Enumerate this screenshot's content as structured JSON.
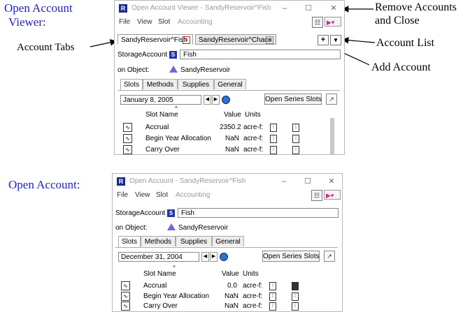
{
  "callouts": {
    "viewer_line1": "Open Account",
    "viewer_line2": "Viewer:",
    "account_tabs": "Account Tabs",
    "remove_line1": "Remove Accounts",
    "remove_line2": "and Close",
    "account_list": "Account List",
    "add_account": "Add Account",
    "open_account": "Open Account:"
  },
  "win1": {
    "title": "Open Account Viewer - SandyReservoir^Fish",
    "menu": [
      "File",
      "View",
      "Slot",
      "Accounting"
    ],
    "tabs": [
      "SandyReservoir^Fish",
      "SandyReservoir^Chaco"
    ],
    "plus": "+",
    "list_btn": "▾",
    "account_type": "StorageAccount",
    "s_badge": "S",
    "account_name": "Fish",
    "on_object_label": "on Object:",
    "object_name": "SandyReservoir",
    "subtabs": [
      "Slots",
      "Methods",
      "Supplies",
      "General"
    ],
    "date": "January 8, 2005",
    "series_btn": "Open Series Slots",
    "col_headers": {
      "name": "Slot Name",
      "value": "Value",
      "units": "Units"
    },
    "rows": [
      {
        "name": "Accrual",
        "value": "2350.2",
        "units": "acre-f:"
      },
      {
        "name": "Begin Year Allocation",
        "value": "NaN",
        "units": "acre-f:"
      },
      {
        "name": "Carry Over",
        "value": "NaN",
        "units": "acre-f:"
      }
    ]
  },
  "win2": {
    "title": "Open Account - SandyReservoir^Fish",
    "menu": [
      "File",
      "View",
      "Slot",
      "Accounting"
    ],
    "account_type": "StorageAccount",
    "s_badge": "S",
    "account_name": "Fish",
    "on_object_label": "on Object:",
    "object_name": "SandyReservoir",
    "subtabs": [
      "Slots",
      "Methods",
      "Supplies",
      "General"
    ],
    "date": "December 31, 2004",
    "series_btn": "Open Series Slots",
    "col_headers": {
      "name": "Slot Name",
      "value": "Value",
      "units": "Units"
    },
    "rows": [
      {
        "name": "Accrual",
        "value": "0.0",
        "units": "acre-f:"
      },
      {
        "name": "Begin Year Allocation",
        "value": "NaN",
        "units": "acre-f:"
      },
      {
        "name": "Carry Over",
        "value": "NaN",
        "units": "acre-f:"
      }
    ]
  },
  "icons": {
    "app": "riverware-logo-icon",
    "minimize": "minimize-icon",
    "maximize": "maximize-icon",
    "close": "close-icon",
    "prev": "arrow-left-icon",
    "next": "arrow-right-icon",
    "globe": "globe-icon",
    "chart": "chart-icon"
  },
  "colors": {
    "callout_blue": "#1f1fd2",
    "tab_close_red": "#d02020",
    "object_icon": "#6a6ad8"
  }
}
